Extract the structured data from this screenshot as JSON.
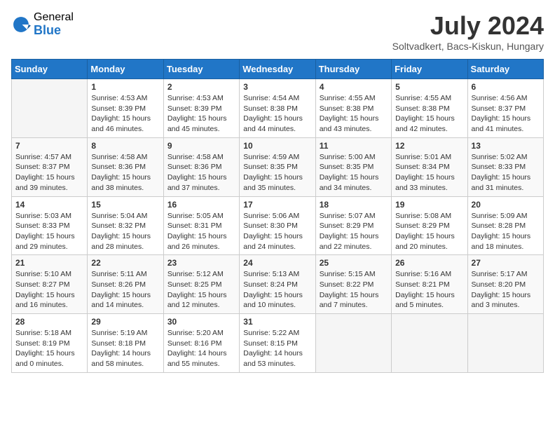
{
  "header": {
    "logo_general": "General",
    "logo_blue": "Blue",
    "title": "July 2024",
    "location": "Soltvadkert, Bacs-Kiskun, Hungary"
  },
  "weekdays": [
    "Sunday",
    "Monday",
    "Tuesday",
    "Wednesday",
    "Thursday",
    "Friday",
    "Saturday"
  ],
  "weeks": [
    [
      {
        "day": "",
        "info": ""
      },
      {
        "day": "1",
        "info": "Sunrise: 4:53 AM\nSunset: 8:39 PM\nDaylight: 15 hours\nand 46 minutes."
      },
      {
        "day": "2",
        "info": "Sunrise: 4:53 AM\nSunset: 8:39 PM\nDaylight: 15 hours\nand 45 minutes."
      },
      {
        "day": "3",
        "info": "Sunrise: 4:54 AM\nSunset: 8:38 PM\nDaylight: 15 hours\nand 44 minutes."
      },
      {
        "day": "4",
        "info": "Sunrise: 4:55 AM\nSunset: 8:38 PM\nDaylight: 15 hours\nand 43 minutes."
      },
      {
        "day": "5",
        "info": "Sunrise: 4:55 AM\nSunset: 8:38 PM\nDaylight: 15 hours\nand 42 minutes."
      },
      {
        "day": "6",
        "info": "Sunrise: 4:56 AM\nSunset: 8:37 PM\nDaylight: 15 hours\nand 41 minutes."
      }
    ],
    [
      {
        "day": "7",
        "info": "Sunrise: 4:57 AM\nSunset: 8:37 PM\nDaylight: 15 hours\nand 39 minutes."
      },
      {
        "day": "8",
        "info": "Sunrise: 4:58 AM\nSunset: 8:36 PM\nDaylight: 15 hours\nand 38 minutes."
      },
      {
        "day": "9",
        "info": "Sunrise: 4:58 AM\nSunset: 8:36 PM\nDaylight: 15 hours\nand 37 minutes."
      },
      {
        "day": "10",
        "info": "Sunrise: 4:59 AM\nSunset: 8:35 PM\nDaylight: 15 hours\nand 35 minutes."
      },
      {
        "day": "11",
        "info": "Sunrise: 5:00 AM\nSunset: 8:35 PM\nDaylight: 15 hours\nand 34 minutes."
      },
      {
        "day": "12",
        "info": "Sunrise: 5:01 AM\nSunset: 8:34 PM\nDaylight: 15 hours\nand 33 minutes."
      },
      {
        "day": "13",
        "info": "Sunrise: 5:02 AM\nSunset: 8:33 PM\nDaylight: 15 hours\nand 31 minutes."
      }
    ],
    [
      {
        "day": "14",
        "info": "Sunrise: 5:03 AM\nSunset: 8:33 PM\nDaylight: 15 hours\nand 29 minutes."
      },
      {
        "day": "15",
        "info": "Sunrise: 5:04 AM\nSunset: 8:32 PM\nDaylight: 15 hours\nand 28 minutes."
      },
      {
        "day": "16",
        "info": "Sunrise: 5:05 AM\nSunset: 8:31 PM\nDaylight: 15 hours\nand 26 minutes."
      },
      {
        "day": "17",
        "info": "Sunrise: 5:06 AM\nSunset: 8:30 PM\nDaylight: 15 hours\nand 24 minutes."
      },
      {
        "day": "18",
        "info": "Sunrise: 5:07 AM\nSunset: 8:29 PM\nDaylight: 15 hours\nand 22 minutes."
      },
      {
        "day": "19",
        "info": "Sunrise: 5:08 AM\nSunset: 8:29 PM\nDaylight: 15 hours\nand 20 minutes."
      },
      {
        "day": "20",
        "info": "Sunrise: 5:09 AM\nSunset: 8:28 PM\nDaylight: 15 hours\nand 18 minutes."
      }
    ],
    [
      {
        "day": "21",
        "info": "Sunrise: 5:10 AM\nSunset: 8:27 PM\nDaylight: 15 hours\nand 16 minutes."
      },
      {
        "day": "22",
        "info": "Sunrise: 5:11 AM\nSunset: 8:26 PM\nDaylight: 15 hours\nand 14 minutes."
      },
      {
        "day": "23",
        "info": "Sunrise: 5:12 AM\nSunset: 8:25 PM\nDaylight: 15 hours\nand 12 minutes."
      },
      {
        "day": "24",
        "info": "Sunrise: 5:13 AM\nSunset: 8:24 PM\nDaylight: 15 hours\nand 10 minutes."
      },
      {
        "day": "25",
        "info": "Sunrise: 5:15 AM\nSunset: 8:22 PM\nDaylight: 15 hours\nand 7 minutes."
      },
      {
        "day": "26",
        "info": "Sunrise: 5:16 AM\nSunset: 8:21 PM\nDaylight: 15 hours\nand 5 minutes."
      },
      {
        "day": "27",
        "info": "Sunrise: 5:17 AM\nSunset: 8:20 PM\nDaylight: 15 hours\nand 3 minutes."
      }
    ],
    [
      {
        "day": "28",
        "info": "Sunrise: 5:18 AM\nSunset: 8:19 PM\nDaylight: 15 hours\nand 0 minutes."
      },
      {
        "day": "29",
        "info": "Sunrise: 5:19 AM\nSunset: 8:18 PM\nDaylight: 14 hours\nand 58 minutes."
      },
      {
        "day": "30",
        "info": "Sunrise: 5:20 AM\nSunset: 8:16 PM\nDaylight: 14 hours\nand 55 minutes."
      },
      {
        "day": "31",
        "info": "Sunrise: 5:22 AM\nSunset: 8:15 PM\nDaylight: 14 hours\nand 53 minutes."
      },
      {
        "day": "",
        "info": ""
      },
      {
        "day": "",
        "info": ""
      },
      {
        "day": "",
        "info": ""
      }
    ]
  ]
}
